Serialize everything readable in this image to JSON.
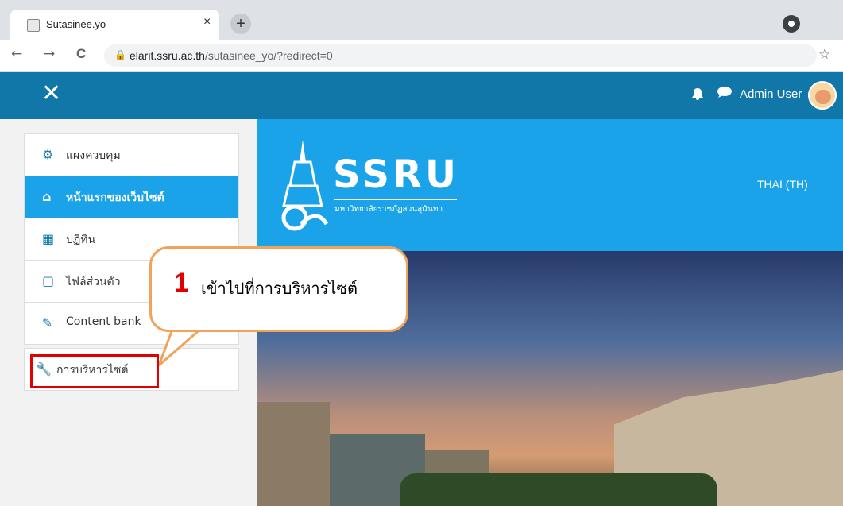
{
  "browser": {
    "tab_title": "Sutasinee.yo",
    "tab_close": "×",
    "new_tab": "+",
    "back": "←",
    "forward": "→",
    "reload": "C",
    "url_host": "elarit.ssru.ac.th",
    "url_path": "/sutasinee_yo/?redirect=0",
    "bookmark": "☆"
  },
  "navbar": {
    "close_glyph": "✕",
    "bell": "🔔",
    "chat": "💬",
    "user_name": "Admin User"
  },
  "sidebar": {
    "items": [
      {
        "icon": "⚙",
        "label": "แผงควบคุม"
      },
      {
        "icon": "⌂",
        "label": "หน้าแรกของเว็บไซต์"
      },
      {
        "icon": "▦",
        "label": "ปฏิทิน"
      },
      {
        "icon": "▢",
        "label": "ไฟล์ส่วนตัว"
      },
      {
        "icon": "✎",
        "label": "Content bank"
      }
    ],
    "admin": {
      "icon": "🔧",
      "label": "การบริหารไซต์"
    }
  },
  "header": {
    "brand": "SSRU",
    "brand_sub": "มหาวิทยาลัยราชภัฏสวนสุนันทา",
    "language": "THAI (TH)"
  },
  "callout": {
    "number": "1",
    "text": "เข้าไปที่การบริหารไซต์"
  },
  "colors": {
    "navbar": "#1177a8",
    "active_item": "#1aa3e8",
    "header": "#1aa3e8",
    "callout_border": "#f0a35a",
    "highlight": "#e00000"
  }
}
